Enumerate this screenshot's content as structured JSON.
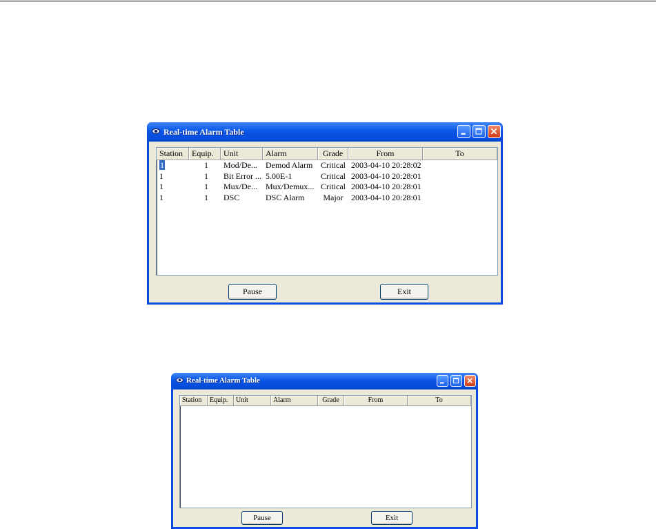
{
  "windows": [
    {
      "title": "Real-time Alarm Table",
      "columns": [
        "Station",
        "Equip.",
        "Unit",
        "Alarm",
        "Grade",
        "From",
        "To"
      ],
      "rows": [
        {
          "station": "1",
          "equip": "1",
          "unit": "Mod/De...",
          "alarm": "Demod Alarm",
          "grade": "Critical",
          "from": "2003-04-10 20:28:02",
          "to": ""
        },
        {
          "station": "1",
          "equip": "1",
          "unit": "Bit Error ...",
          "alarm": "5.00E-1",
          "grade": "Critical",
          "from": "2003-04-10 20:28:01",
          "to": ""
        },
        {
          "station": "1",
          "equip": "1",
          "unit": "Mux/De...",
          "alarm": "Mux/Demux...",
          "grade": "Critical",
          "from": "2003-04-10 20:28:01",
          "to": ""
        },
        {
          "station": "1",
          "equip": "1",
          "unit": "DSC",
          "alarm": "DSC Alarm",
          "grade": "Major",
          "from": "2003-04-10 20:28:01",
          "to": ""
        }
      ],
      "buttons": {
        "pause": "Pause",
        "exit": "Exit"
      }
    },
    {
      "title": "Real-time Alarm Table",
      "columns": [
        "Station",
        "Equip.",
        "Unit",
        "Alarm",
        "Grade",
        "From",
        "To"
      ],
      "rows": [],
      "buttons": {
        "pause": "Pause",
        "exit": "Exit"
      }
    }
  ],
  "colors": {
    "titlebar": "#0a56e6",
    "selection": "#316ac5",
    "face": "#ece9d8"
  }
}
